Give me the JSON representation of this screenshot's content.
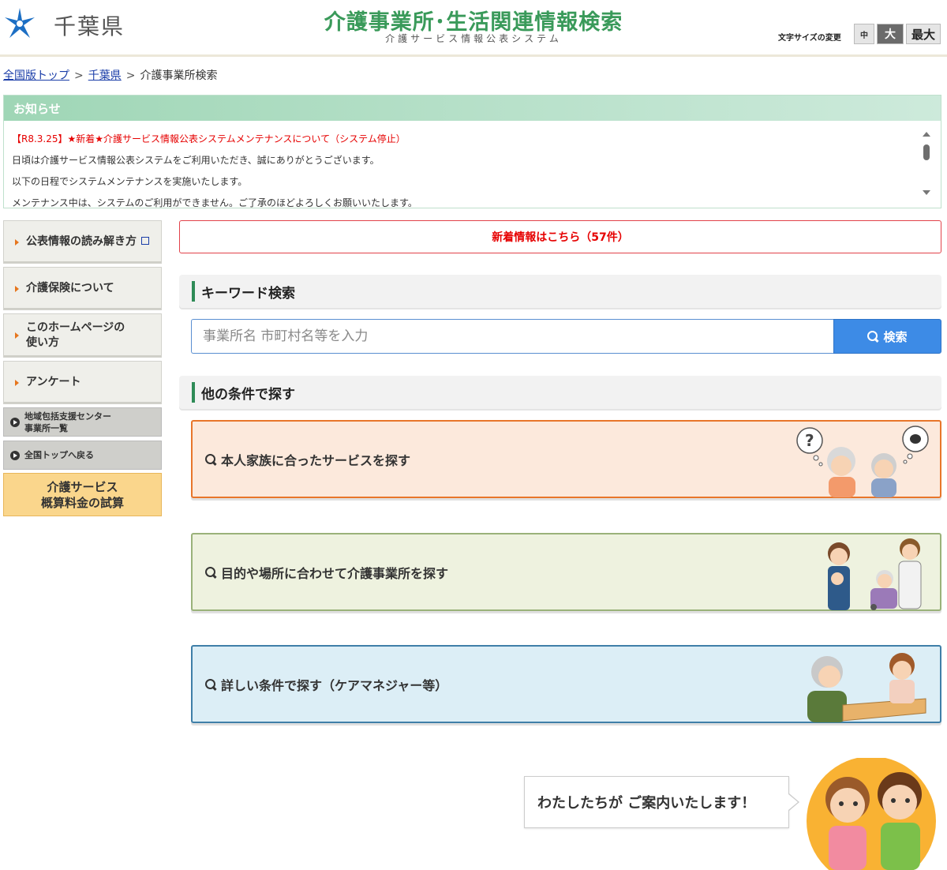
{
  "header": {
    "prefecture_name": "千葉県",
    "site_title": "介護事業所･生活関連情報検索",
    "site_subtitle": "介護サービス情報公表システム",
    "font_size_label": "文字サイズの変更",
    "font_size_options": [
      "中",
      "大",
      "最大"
    ],
    "font_size_selected": "大"
  },
  "breadcrumb": {
    "items": [
      "全国版トップ",
      "千葉県",
      "介護事業所検索"
    ],
    "separator": ">"
  },
  "notice": {
    "heading": "お知らせ",
    "title": "【R8.3.25】★新着★介護サービス情報公表システムメンテナンスについて（システム停止）",
    "lines": [
      "日頃は介護サービス情報公表システムをご利用いただき、誠にありがとうございます。",
      "以下の日程でシステムメンテナンスを実施いたします。",
      "メンテナンス中は、システムのご利用ができません。ご了承のほどよろしくお願いいたします。"
    ]
  },
  "sidebar": {
    "items": [
      {
        "label": "公表情報の読み解き方",
        "external": true
      },
      {
        "label": "介護保険について"
      },
      {
        "label_line1": "このホームページの",
        "label_line2": "使い方"
      },
      {
        "label": "アンケート"
      }
    ],
    "small_items": [
      {
        "label_line1": "地域包括支援センター",
        "label_line2": "事業所一覧"
      },
      {
        "label": "全国トップへ戻る"
      }
    ],
    "fee_button": {
      "line1": "介護サービス",
      "line2": "概算料金の試算"
    }
  },
  "main": {
    "new_info": "新着情報はこちら（57件）",
    "keyword_heading": "キーワード検索",
    "search_placeholder": "事業所名 市町村名等を入力",
    "search_value": "",
    "search_button": "検索",
    "conditions_heading": "他の条件で探す",
    "cards": [
      {
        "label": "本人家族に合ったサービスを探す",
        "color": "#e8762a",
        "bg": "#fce9dc"
      },
      {
        "label": "目的や場所に合わせて介護事業所を探す",
        "color": "#9ab27a",
        "bg": "#eef2df"
      },
      {
        "label": "詳しい条件で探す（ケアマネジャー等）",
        "color": "#3f7fa8",
        "bg": "#dceef6"
      }
    ],
    "guide_message": "わたしたちが ご案内いたします！"
  },
  "colors": {
    "accent_green": "#3a9a5a",
    "notice_red": "#e60000",
    "search_blue": "#3d8be6",
    "link_blue": "#1a3da8"
  },
  "icons": [
    "chiba-prefecture-logo-icon",
    "search-icon",
    "external-link-icon",
    "triangle-right-icon",
    "play-circle-icon"
  ]
}
